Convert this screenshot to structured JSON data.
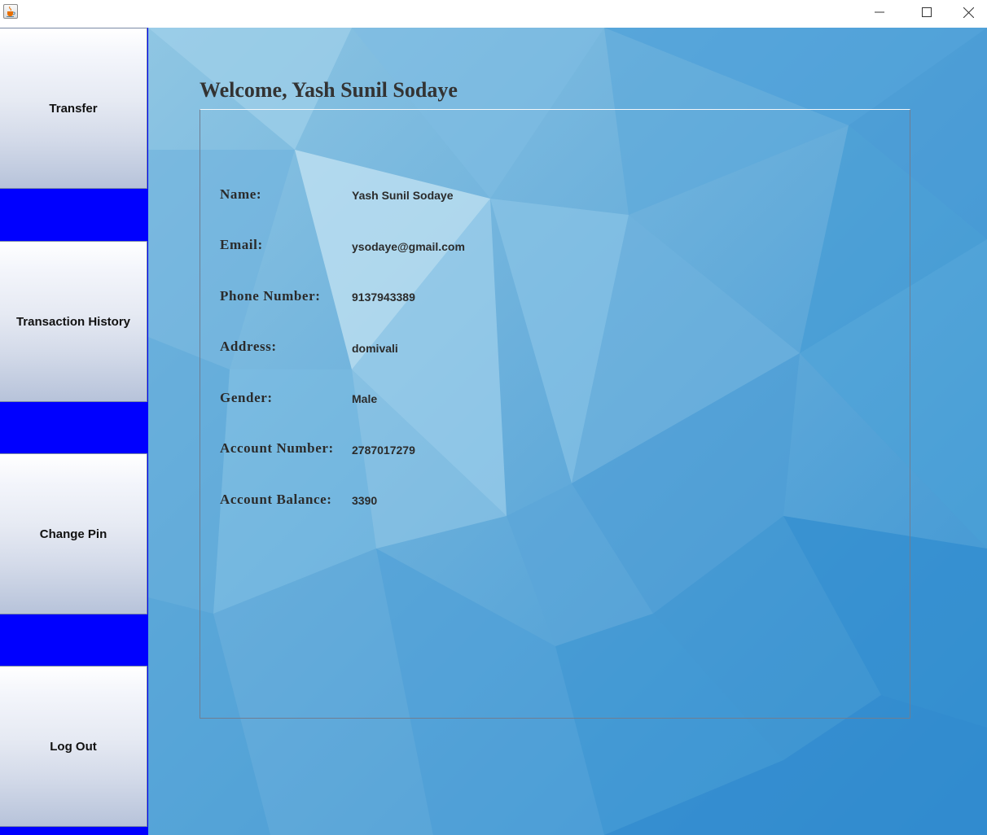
{
  "window": {
    "icon": "java-cup-icon",
    "controls": {
      "minimize": "minimize-icon",
      "maximize": "maximize-icon",
      "close": "close-icon"
    }
  },
  "sidebar": {
    "background_color": "#0000ff",
    "buttons": [
      {
        "label": "Transfer"
      },
      {
        "label": "Transaction History"
      },
      {
        "label": "Change Pin"
      },
      {
        "label": "Log Out"
      }
    ]
  },
  "main": {
    "welcome": "Welcome, Yash Sunil Sodaye",
    "details": [
      {
        "label": "Name:",
        "value": "Yash Sunil Sodaye"
      },
      {
        "label": "Email:",
        "value": "ysodaye@gmail.com"
      },
      {
        "label": "Phone Number:",
        "value": "9137943389"
      },
      {
        "label": "Address:",
        "value": "domivali"
      },
      {
        "label": "Gender:",
        "value": "Male"
      },
      {
        "label": "Account Number:",
        "value": "2787017279"
      },
      {
        "label": "Account Balance:",
        "value": "3390"
      }
    ]
  }
}
